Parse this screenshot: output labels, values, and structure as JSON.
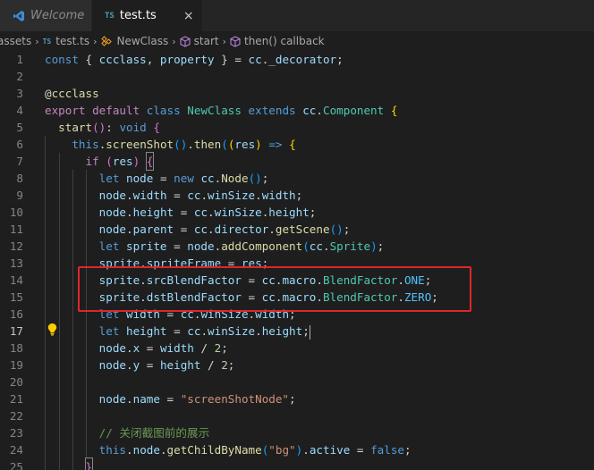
{
  "tabs": [
    {
      "label": "Welcome",
      "icon": "vscode-icon",
      "active": false
    },
    {
      "label": "test.ts",
      "icon": "ts-icon",
      "badge": "TS",
      "active": true,
      "close": "×"
    }
  ],
  "breadcrumb": {
    "items": [
      "assets",
      "test.ts",
      "NewClass",
      "start",
      "then() callback"
    ],
    "ts_badge": "TS",
    "separator": "›"
  },
  "editor": {
    "current_line": 17,
    "highlight_color": "#e0262a",
    "lines": [
      {
        "n": "1",
        "tokens": [
          [
            "kw",
            "const"
          ],
          [
            "pun",
            " { "
          ],
          [
            "var",
            "ccclass"
          ],
          [
            "pun",
            ", "
          ],
          [
            "var",
            "property"
          ],
          [
            "pun",
            " } = "
          ],
          [
            "var",
            "cc"
          ],
          [
            "pun",
            "."
          ],
          [
            "var",
            "_decorator"
          ],
          [
            "pun",
            ";"
          ]
        ]
      },
      {
        "n": "2",
        "tokens": []
      },
      {
        "n": "3",
        "tokens": [
          [
            "pun",
            "@"
          ],
          [
            "fn",
            "ccclass"
          ]
        ]
      },
      {
        "n": "4",
        "tokens": [
          [
            "ctrl",
            "export"
          ],
          [
            "pun",
            " "
          ],
          [
            "ctrl",
            "default"
          ],
          [
            "pun",
            " "
          ],
          [
            "kw",
            "class"
          ],
          [
            "pun",
            " "
          ],
          [
            "cls",
            "NewClass"
          ],
          [
            "pun",
            " "
          ],
          [
            "kw",
            "extends"
          ],
          [
            "pun",
            " "
          ],
          [
            "var",
            "cc"
          ],
          [
            "pun",
            "."
          ],
          [
            "cls",
            "Component"
          ],
          [
            "pun",
            " "
          ],
          [
            "brk1",
            "{"
          ]
        ]
      },
      {
        "n": "5",
        "tokens": [
          [
            "pun",
            "  "
          ],
          [
            "fn",
            "start"
          ],
          [
            "brk2",
            "()"
          ],
          [
            "pun",
            ": "
          ],
          [
            "kw",
            "void"
          ],
          [
            "pun",
            " "
          ],
          [
            "brk2",
            "{"
          ]
        ]
      },
      {
        "n": "6",
        "tokens": [
          [
            "pun",
            "    "
          ],
          [
            "kw",
            "this"
          ],
          [
            "pun",
            "."
          ],
          [
            "fn",
            "screenShot"
          ],
          [
            "brk3",
            "()"
          ],
          [
            "pun",
            "."
          ],
          [
            "fn",
            "then"
          ],
          [
            "brk3",
            "("
          ],
          [
            "brk1",
            "("
          ],
          [
            "var",
            "res"
          ],
          [
            "brk1",
            ")"
          ],
          [
            "pun",
            " "
          ],
          [
            "kw",
            "=>"
          ],
          [
            "pun",
            " "
          ],
          [
            "brk1",
            "{"
          ]
        ]
      },
      {
        "n": "7",
        "tokens": [
          [
            "pun",
            "      "
          ],
          [
            "ctrl",
            "if"
          ],
          [
            "pun",
            " "
          ],
          [
            "brk2",
            "("
          ],
          [
            "var",
            "res"
          ],
          [
            "brk2",
            ")"
          ],
          [
            "pun",
            " "
          ],
          [
            "brk2box",
            "{"
          ]
        ]
      },
      {
        "n": "8",
        "tokens": [
          [
            "pun",
            "        "
          ],
          [
            "kw",
            "let"
          ],
          [
            "pun",
            " "
          ],
          [
            "var",
            "node"
          ],
          [
            "pun",
            " = "
          ],
          [
            "kw",
            "new"
          ],
          [
            "pun",
            " "
          ],
          [
            "var",
            "cc"
          ],
          [
            "pun",
            "."
          ],
          [
            "fn",
            "Node"
          ],
          [
            "brk3",
            "()"
          ],
          [
            "pun",
            ";"
          ]
        ]
      },
      {
        "n": "9",
        "tokens": [
          [
            "pun",
            "        "
          ],
          [
            "var",
            "node"
          ],
          [
            "pun",
            "."
          ],
          [
            "var",
            "width"
          ],
          [
            "pun",
            " = "
          ],
          [
            "var",
            "cc"
          ],
          [
            "pun",
            "."
          ],
          [
            "var",
            "winSize"
          ],
          [
            "pun",
            "."
          ],
          [
            "var",
            "width"
          ],
          [
            "pun",
            ";"
          ]
        ]
      },
      {
        "n": "10",
        "tokens": [
          [
            "pun",
            "        "
          ],
          [
            "var",
            "node"
          ],
          [
            "pun",
            "."
          ],
          [
            "var",
            "height"
          ],
          [
            "pun",
            " = "
          ],
          [
            "var",
            "cc"
          ],
          [
            "pun",
            "."
          ],
          [
            "var",
            "winSize"
          ],
          [
            "pun",
            "."
          ],
          [
            "var",
            "height"
          ],
          [
            "pun",
            ";"
          ]
        ]
      },
      {
        "n": "11",
        "tokens": [
          [
            "pun",
            "        "
          ],
          [
            "var",
            "node"
          ],
          [
            "pun",
            "."
          ],
          [
            "var",
            "parent"
          ],
          [
            "pun",
            " = "
          ],
          [
            "var",
            "cc"
          ],
          [
            "pun",
            "."
          ],
          [
            "var",
            "director"
          ],
          [
            "pun",
            "."
          ],
          [
            "fn",
            "getScene"
          ],
          [
            "brk3",
            "()"
          ],
          [
            "pun",
            ";"
          ]
        ]
      },
      {
        "n": "12",
        "tokens": [
          [
            "pun",
            "        "
          ],
          [
            "kw",
            "let"
          ],
          [
            "pun",
            " "
          ],
          [
            "var",
            "sprite"
          ],
          [
            "pun",
            " = "
          ],
          [
            "var",
            "node"
          ],
          [
            "pun",
            "."
          ],
          [
            "fn",
            "addComponent"
          ],
          [
            "brk3",
            "("
          ],
          [
            "var",
            "cc"
          ],
          [
            "pun",
            "."
          ],
          [
            "cls",
            "Sprite"
          ],
          [
            "brk3",
            ")"
          ],
          [
            "pun",
            ";"
          ]
        ]
      },
      {
        "n": "13",
        "tokens": [
          [
            "pun",
            "        "
          ],
          [
            "var",
            "sprite"
          ],
          [
            "pun",
            "."
          ],
          [
            "var",
            "spriteFrame"
          ],
          [
            "pun",
            " = "
          ],
          [
            "var",
            "res"
          ],
          [
            "pun",
            ";"
          ]
        ]
      },
      {
        "n": "14",
        "tokens": [
          [
            "pun",
            "        "
          ],
          [
            "var",
            "sprite"
          ],
          [
            "pun",
            "."
          ],
          [
            "var",
            "srcBlendFactor"
          ],
          [
            "pun",
            " = "
          ],
          [
            "var",
            "cc"
          ],
          [
            "pun",
            "."
          ],
          [
            "var",
            "macro"
          ],
          [
            "pun",
            "."
          ],
          [
            "cls",
            "BlendFactor"
          ],
          [
            "pun",
            "."
          ],
          [
            "const",
            "ONE"
          ],
          [
            "pun",
            ";"
          ]
        ]
      },
      {
        "n": "15",
        "tokens": [
          [
            "pun",
            "        "
          ],
          [
            "var",
            "sprite"
          ],
          [
            "pun",
            "."
          ],
          [
            "var",
            "dstBlendFactor"
          ],
          [
            "pun",
            " = "
          ],
          [
            "var",
            "cc"
          ],
          [
            "pun",
            "."
          ],
          [
            "var",
            "macro"
          ],
          [
            "pun",
            "."
          ],
          [
            "cls",
            "BlendFactor"
          ],
          [
            "pun",
            "."
          ],
          [
            "const",
            "ZERO"
          ],
          [
            "pun",
            ";"
          ]
        ]
      },
      {
        "n": "16",
        "tokens": [
          [
            "pun",
            "        "
          ],
          [
            "kw",
            "let"
          ],
          [
            "pun",
            " "
          ],
          [
            "var",
            "width"
          ],
          [
            "pun",
            " = "
          ],
          [
            "var",
            "cc"
          ],
          [
            "pun",
            "."
          ],
          [
            "var",
            "winSize"
          ],
          [
            "pun",
            "."
          ],
          [
            "var",
            "width"
          ],
          [
            "pun",
            ";"
          ]
        ]
      },
      {
        "n": "17",
        "tokens": [
          [
            "pun",
            "        "
          ],
          [
            "kw",
            "let"
          ],
          [
            "pun",
            " "
          ],
          [
            "var",
            "height"
          ],
          [
            "pun",
            " = "
          ],
          [
            "var",
            "cc"
          ],
          [
            "pun",
            "."
          ],
          [
            "var",
            "winSize"
          ],
          [
            "pun",
            "."
          ],
          [
            "var",
            "height"
          ],
          [
            "pun",
            ";"
          ],
          [
            "cursor",
            ""
          ]
        ]
      },
      {
        "n": "18",
        "tokens": [
          [
            "pun",
            "        "
          ],
          [
            "var",
            "node"
          ],
          [
            "pun",
            "."
          ],
          [
            "var",
            "x"
          ],
          [
            "pun",
            " = "
          ],
          [
            "var",
            "width"
          ],
          [
            "pun",
            " / "
          ],
          [
            "num",
            "2"
          ],
          [
            "pun",
            ";"
          ]
        ]
      },
      {
        "n": "19",
        "tokens": [
          [
            "pun",
            "        "
          ],
          [
            "var",
            "node"
          ],
          [
            "pun",
            "."
          ],
          [
            "var",
            "y"
          ],
          [
            "pun",
            " = "
          ],
          [
            "var",
            "height"
          ],
          [
            "pun",
            " / "
          ],
          [
            "num",
            "2"
          ],
          [
            "pun",
            ";"
          ]
        ]
      },
      {
        "n": "20",
        "tokens": []
      },
      {
        "n": "21",
        "tokens": [
          [
            "pun",
            "        "
          ],
          [
            "var",
            "node"
          ],
          [
            "pun",
            "."
          ],
          [
            "var",
            "name"
          ],
          [
            "pun",
            " = "
          ],
          [
            "str",
            "\"screenShotNode\""
          ],
          [
            "pun",
            ";"
          ]
        ]
      },
      {
        "n": "22",
        "tokens": []
      },
      {
        "n": "23",
        "tokens": [
          [
            "pun",
            "        "
          ],
          [
            "cmt",
            "// 关闭截图前的展示"
          ]
        ]
      },
      {
        "n": "24",
        "tokens": [
          [
            "pun",
            "        "
          ],
          [
            "kw",
            "this"
          ],
          [
            "pun",
            "."
          ],
          [
            "var",
            "node"
          ],
          [
            "pun",
            "."
          ],
          [
            "fn",
            "getChildByName"
          ],
          [
            "brk3",
            "("
          ],
          [
            "str",
            "\"bg\""
          ],
          [
            "brk3",
            ")"
          ],
          [
            "pun",
            "."
          ],
          [
            "var",
            "active"
          ],
          [
            "pun",
            " = "
          ],
          [
            "kw",
            "false"
          ],
          [
            "pun",
            ";"
          ]
        ]
      },
      {
        "n": "25",
        "tokens": [
          [
            "pun",
            "      "
          ],
          [
            "brk2box",
            "}"
          ]
        ]
      }
    ]
  }
}
